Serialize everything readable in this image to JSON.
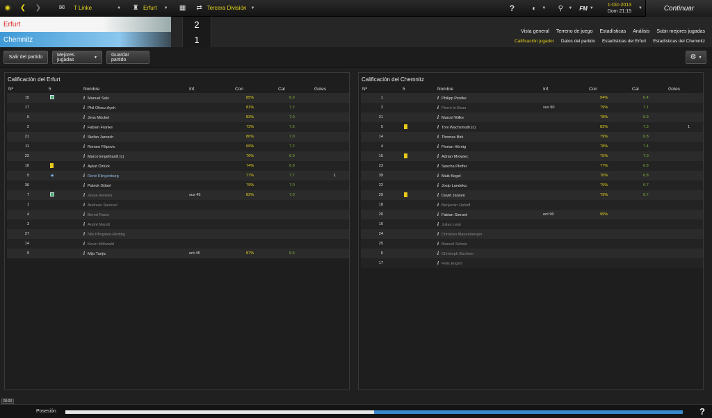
{
  "topbar": {
    "manager": "T Linke",
    "club": "Erfurt",
    "competition": "Tercera División",
    "fm_label": "FM",
    "date": "1-Dic-2013",
    "day_time": "Dom 21:15",
    "continue_label": "Continuar"
  },
  "match": {
    "home_team": "Erfurt",
    "away_team": "Chemnitz",
    "home_score": "2",
    "away_score": "1"
  },
  "tabs": {
    "row1": [
      "Vista general",
      "Terreno de juego",
      "Estadísticas",
      "Análisis",
      "Subir mejores jugadas"
    ],
    "row2": [
      "Calificación jugador",
      "Datos del partido",
      "Estadísticas del Erfurt",
      "Estadísticas del Chemnitz"
    ]
  },
  "toolbar": {
    "exit_label": "Salir del partido",
    "highlights_label": "Mejores jugadas",
    "save_label": "Guardar partido"
  },
  "columns": {
    "number": "Nº",
    "pos": "5",
    "name": "Nombre",
    "info": "Inf.",
    "con": "Con",
    "cal": "Cal",
    "goals": "Goles"
  },
  "home_panel": {
    "title": "Calificación del Erfurt",
    "rows": [
      {
        "num": "15",
        "mark": "green",
        "name": "Manuel Salz",
        "info": "",
        "con": "85%",
        "cal": "6.9",
        "goals": "",
        "style": ""
      },
      {
        "num": "17",
        "mark": "",
        "name": "Phil Ofosu-Ayeh",
        "info": "",
        "con": "81%",
        "cal": "7.2",
        "goals": "",
        "style": ""
      },
      {
        "num": "6",
        "mark": "",
        "name": "Jens Möckel",
        "info": "",
        "con": "83%",
        "cal": "7.0",
        "goals": "",
        "style": ""
      },
      {
        "num": "2",
        "mark": "",
        "name": "Fabian Franke",
        "info": "",
        "con": "73%",
        "cal": "7.6",
        "goals": "",
        "style": ""
      },
      {
        "num": "21",
        "mark": "",
        "name": "Stefan Jarosch",
        "info": "",
        "con": "80%",
        "cal": "7.0",
        "goals": "",
        "style": ""
      },
      {
        "num": "11",
        "mark": "",
        "name": "Romeo Filipovic",
        "info": "",
        "con": "69%",
        "cal": "7.2",
        "goals": "",
        "style": ""
      },
      {
        "num": "22",
        "mark": "",
        "name": "Marco Engelhardt (c)",
        "info": "",
        "con": "76%",
        "cal": "6.9",
        "goals": "",
        "style": ""
      },
      {
        "num": "10",
        "mark": "yellow",
        "name": "Aykut Öztürk",
        "info": "",
        "con": "74%",
        "cal": "6.9",
        "goals": "",
        "style": ""
      },
      {
        "num": "5",
        "mark": "star",
        "name": "René Klingenburg",
        "info": "",
        "con": "77%",
        "cal": "7.7",
        "goals": "1",
        "style": "hl"
      },
      {
        "num": "36",
        "mark": "",
        "name": "Patrick Göbel",
        "info": "",
        "con": "79%",
        "cal": "7.0",
        "goals": "",
        "style": ""
      },
      {
        "num": "7",
        "mark": "green",
        "name": "Jesse Renken",
        "info": "sus 45",
        "con": "82%",
        "cal": "7.0",
        "goals": "",
        "style": "dim"
      },
      {
        "num": "1",
        "mark": "",
        "name": "Andreas Sponsel",
        "info": "",
        "con": "",
        "cal": "",
        "goals": "",
        "style": "dim"
      },
      {
        "num": "4",
        "mark": "",
        "name": "Bernd Rauw",
        "info": "",
        "con": "",
        "cal": "",
        "goals": "",
        "style": "dim"
      },
      {
        "num": "3",
        "mark": "",
        "name": "André Mandt",
        "info": "",
        "con": "",
        "cal": "",
        "goals": "",
        "style": "dim"
      },
      {
        "num": "27",
        "mark": "",
        "name": "Nils Pfingsten-Reddig",
        "info": "",
        "con": "",
        "cal": "",
        "goals": "",
        "style": "dim"
      },
      {
        "num": "14",
        "mark": "",
        "name": "Kevin Möhwald",
        "info": "",
        "con": "",
        "cal": "",
        "goals": "",
        "style": "dim"
      },
      {
        "num": "9",
        "mark": "",
        "name": "Mijo Tunjic",
        "info": "ent 45",
        "con": "87%",
        "cal": "6.5",
        "goals": "",
        "style": ""
      }
    ]
  },
  "away_panel": {
    "title": "Calificación del Chemnitz",
    "rows": [
      {
        "num": "1",
        "mark": "",
        "name": "Philipp Pentke",
        "info": "",
        "con": "94%",
        "cal": "6.4",
        "goals": "",
        "style": ""
      },
      {
        "num": "2",
        "mark": "",
        "name": "Pierre le Beau",
        "info": "sus 90",
        "con": "79%",
        "cal": "7.1",
        "goals": "",
        "style": "dim"
      },
      {
        "num": "21",
        "mark": "",
        "name": "Marcel Wilke",
        "info": "",
        "con": "78%",
        "cal": "6.9",
        "goals": "",
        "style": ""
      },
      {
        "num": "5",
        "mark": "yellow",
        "name": "Toni Wachsmuth (c)",
        "info": "",
        "con": "83%",
        "cal": "7.3",
        "goals": "1",
        "style": ""
      },
      {
        "num": "14",
        "mark": "",
        "name": "Thomas Birk",
        "info": "",
        "con": "79%",
        "cal": "6.8",
        "goals": "",
        "style": ""
      },
      {
        "num": "4",
        "mark": "",
        "name": "Florian Hörnig",
        "info": "",
        "con": "78%",
        "cal": "7.4",
        "goals": "",
        "style": ""
      },
      {
        "num": "15",
        "mark": "yellow",
        "name": "Adrian Mrowiec",
        "info": "",
        "con": "75%",
        "cal": "7.0",
        "goals": "",
        "style": ""
      },
      {
        "num": "23",
        "mark": "",
        "name": "Sascha Pfeffer",
        "info": "",
        "con": "77%",
        "cal": "6.8",
        "goals": "",
        "style": ""
      },
      {
        "num": "39",
        "mark": "",
        "name": "Maik Kegel",
        "info": "",
        "con": "70%",
        "cal": "6.8",
        "goals": "",
        "style": ""
      },
      {
        "num": "22",
        "mark": "",
        "name": "Josip Landeka",
        "info": "",
        "con": "79%",
        "cal": "6.7",
        "goals": "",
        "style": ""
      },
      {
        "num": "29",
        "mark": "yellow",
        "name": "David Jansen",
        "info": "",
        "con": "79%",
        "cal": "6.7",
        "goals": "",
        "style": ""
      },
      {
        "num": "18",
        "mark": "",
        "name": "Benjamin Uphoff",
        "info": "",
        "con": "",
        "cal": "",
        "goals": "",
        "style": "dim"
      },
      {
        "num": "20",
        "mark": "",
        "name": "Fabian Stenzel",
        "info": "ent 90",
        "con": "99%",
        "cal": "",
        "goals": "",
        "style": ""
      },
      {
        "num": "16",
        "mark": "",
        "name": "Julian Leist",
        "info": "",
        "con": "",
        "cal": "",
        "goals": "",
        "style": "dim"
      },
      {
        "num": "24",
        "mark": "",
        "name": "Christian Mauersberger",
        "info": "",
        "con": "",
        "cal": "",
        "goals": "",
        "style": "dim"
      },
      {
        "num": "25",
        "mark": "",
        "name": "Manuel Scholz",
        "info": "",
        "con": "",
        "cal": "",
        "goals": "",
        "style": "dim"
      },
      {
        "num": "6",
        "mark": "",
        "name": "Christoph Buchner",
        "info": "",
        "con": "",
        "cal": "",
        "goals": "",
        "style": "dim"
      },
      {
        "num": "17",
        "mark": "",
        "name": "Felix Engert",
        "info": "",
        "con": "",
        "cal": "",
        "goals": "",
        "style": "dim"
      }
    ]
  },
  "bottom": {
    "time_badge": "00:00",
    "possession_label": "Posesión",
    "home_possession_fraction": 0.5
  }
}
